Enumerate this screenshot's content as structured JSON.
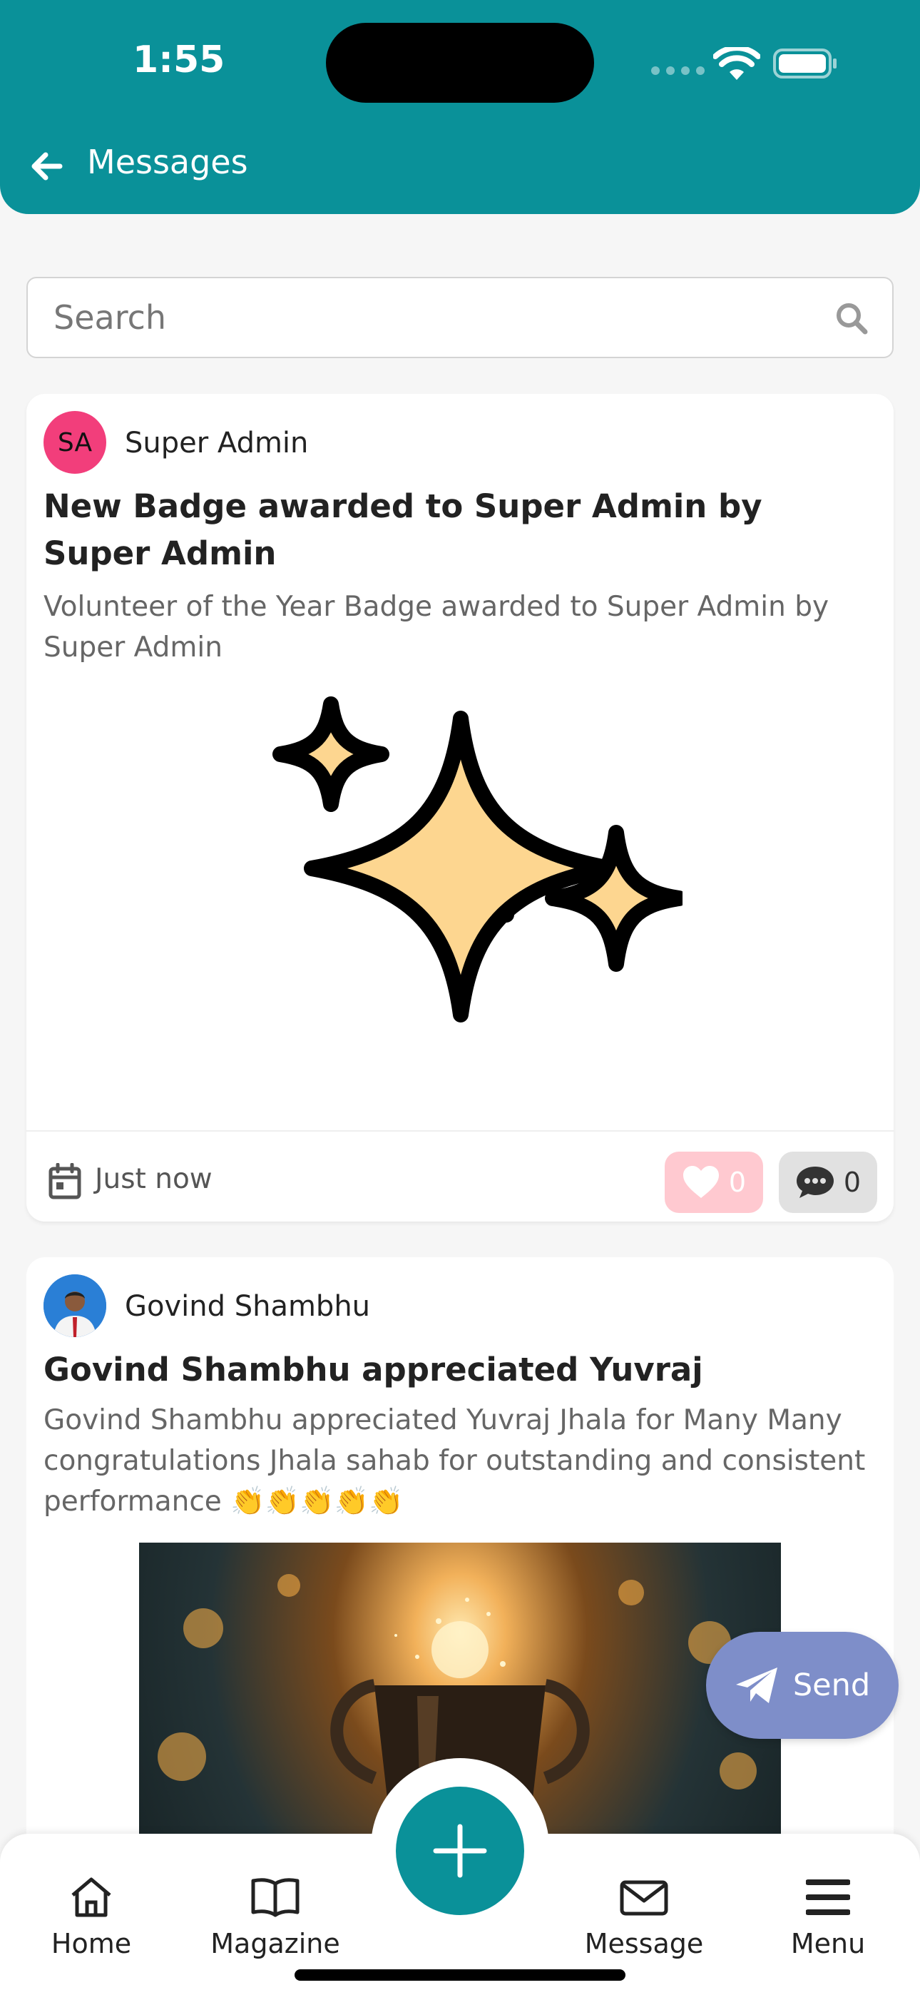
{
  "status_bar": {
    "time": "1:55"
  },
  "header": {
    "title": "Messages"
  },
  "search": {
    "placeholder": "Search",
    "value": ""
  },
  "posts": [
    {
      "avatar_initials": "SA",
      "author": "Super Admin",
      "title": "New Badge awarded to Super Admin by Super Admin",
      "description": "Volunteer of the Year Badge awarded to Super Admin by Super Admin",
      "timestamp": "Just now",
      "likes": "0",
      "comments": "0"
    },
    {
      "author": "Govind Shambhu",
      "title": "Govind Shambhu appreciated Yuvraj",
      "description": "Govind Shambhu appreciated Yuvraj Jhala for Many Many congratulations Jhala sahab for outstanding and consistent performance 👏👏👏👏👏"
    }
  ],
  "send_button": {
    "label": "Send"
  },
  "nav": {
    "home": "Home",
    "magazine": "Magazine",
    "message": "Message",
    "menu": "Menu"
  },
  "colors": {
    "brand": "#0a9199",
    "avatar": "#f23e7b",
    "like_bg": "#ffc9d0",
    "send_bg": "#7e8ec9"
  }
}
